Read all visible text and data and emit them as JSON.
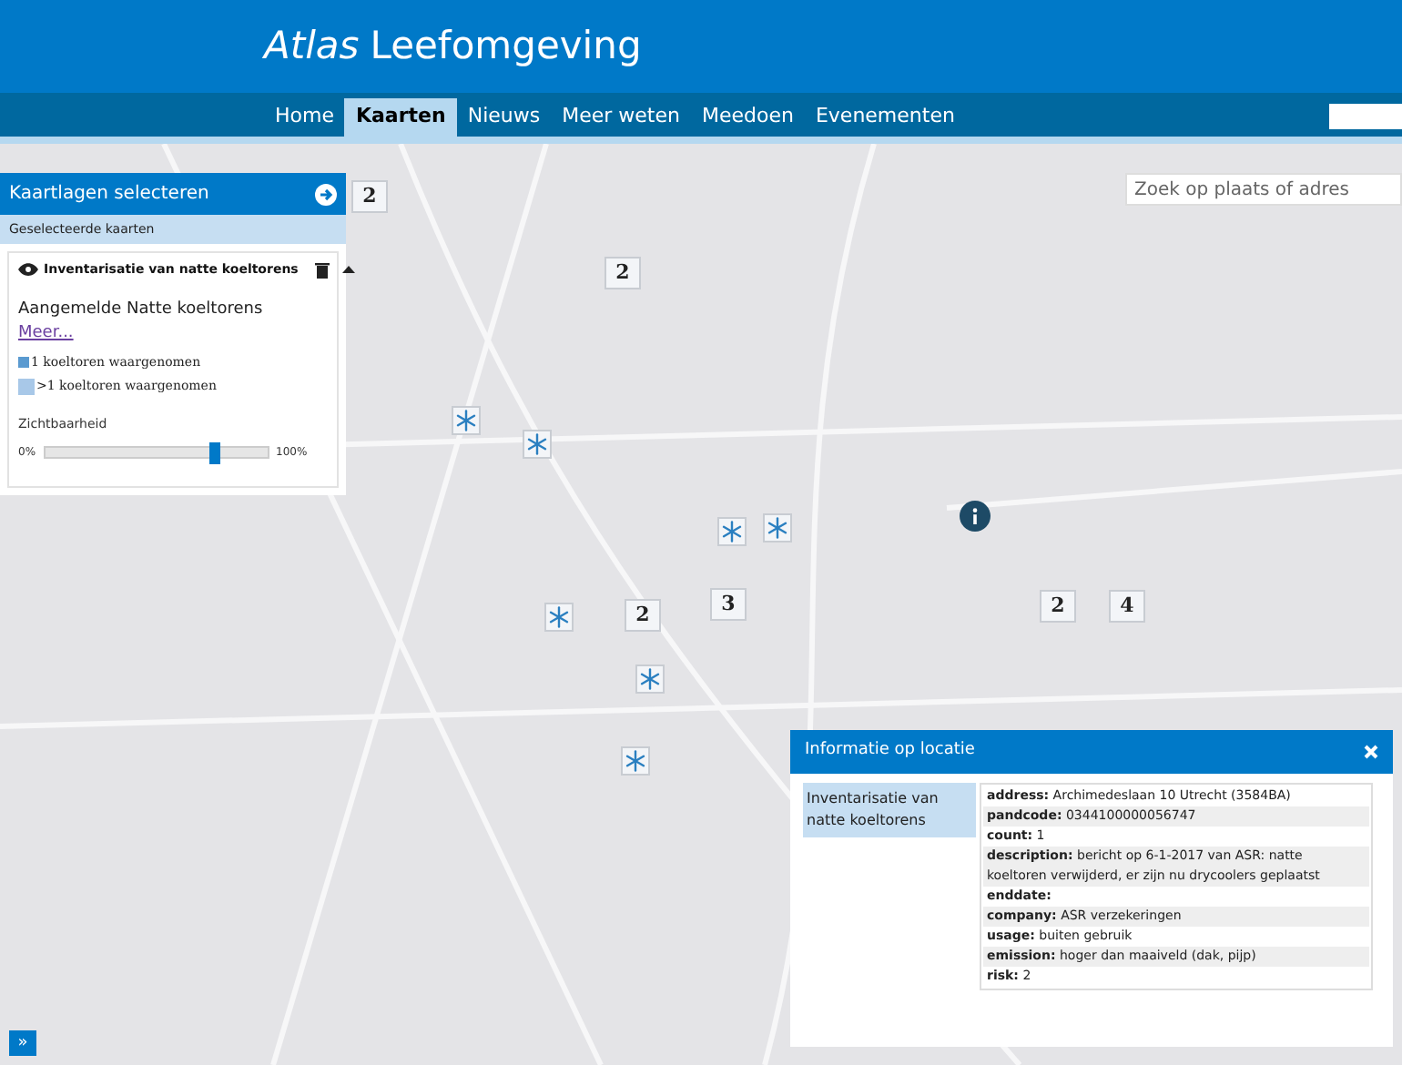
{
  "header": {
    "title_italic": "Atlas",
    "title": "Leefomgeving"
  },
  "nav": [
    {
      "label": "Home",
      "selected": false
    },
    {
      "label": "Kaarten",
      "selected": true
    },
    {
      "label": "Nieuws",
      "selected": false
    },
    {
      "label": "Meer weten",
      "selected": false
    },
    {
      "label": "Meedoen",
      "selected": false
    },
    {
      "label": "Evenementen",
      "selected": false
    }
  ],
  "search": {
    "placeholder": "Zoek op plaats of adres"
  },
  "layer_panel": {
    "title": "Kaartlagen selecteren",
    "section": "Geselecteerde kaarten",
    "layer": {
      "title": "Inventarisatie van natte koeltorens",
      "visible": true,
      "expanded": true,
      "description": "Aangemelde Natte koeltorens",
      "link": "Meer...",
      "legend": [
        {
          "kind": "single",
          "label": "1 koeltoren waargenomen"
        },
        {
          "kind": "cluster",
          "label": ">1 koeltoren waargenomen"
        }
      ],
      "opacity_label": "Zichtbaarheid",
      "min": "0%",
      "max": "100%",
      "level": 0.77
    }
  },
  "markers": [
    {
      "kind": "cluster",
      "count": "2"
    },
    {
      "kind": "cluster",
      "count": "2"
    },
    {
      "kind": "single"
    },
    {
      "kind": "single"
    },
    {
      "kind": "single"
    },
    {
      "kind": "single"
    },
    {
      "kind": "info"
    },
    {
      "kind": "cluster",
      "count": "3"
    },
    {
      "kind": "cluster",
      "count": "2"
    },
    {
      "kind": "single"
    },
    {
      "kind": "single"
    },
    {
      "kind": "single"
    },
    {
      "kind": "cluster",
      "count": "2"
    },
    {
      "kind": "cluster",
      "count": "4"
    }
  ],
  "info_popup": {
    "title": "Informatie op locatie",
    "layer": "Inventarisatie van natte koeltorens",
    "attributes": [
      {
        "key": "address:",
        "value": "Archimedeslaan 10 Utrecht (3584BA)"
      },
      {
        "key": "pandcode:",
        "value": "0344100000056747"
      },
      {
        "key": "count:",
        "value": "1"
      },
      {
        "key": "description:",
        "value": "bericht op 6-1-2017 van ASR: natte koeltoren verwijderd, er zijn nu drycoolers geplaatst"
      },
      {
        "key": "enddate:"
      },
      {
        "key": "company:",
        "value": "ASR verzekeringen"
      },
      {
        "key": "usage:",
        "value": "buiten gebruik"
      },
      {
        "key": "emission:",
        "value": "hoger dan maaiveld (dak, pijp)"
      },
      {
        "key": "risk:",
        "value": "2"
      }
    ]
  },
  "expand_button": "»"
}
